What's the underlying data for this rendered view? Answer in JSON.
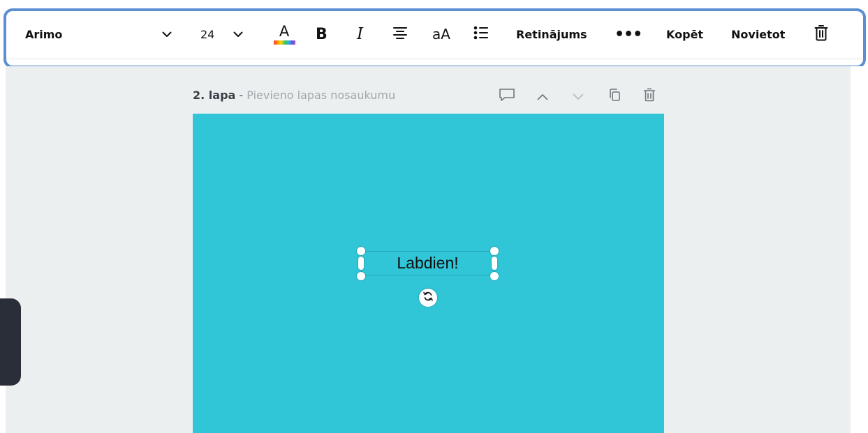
{
  "toolbar": {
    "font_name": "Arimo",
    "font_size": "24",
    "color_letter": "A",
    "bold_label": "B",
    "italic_label": "I",
    "case_label": "aA",
    "spacing_label": "Retinājums",
    "more_label": "•••",
    "copy_label": "Kopēt",
    "position_label": "Novietot",
    "icons": [
      "chevron-down-icon",
      "text-color-icon",
      "align-center-icon",
      "list-icon",
      "trash-icon"
    ]
  },
  "page": {
    "number_label": "2. lapa",
    "separator": " - ",
    "title_placeholder": "Pievieno lapas nosaukumu",
    "background_color": "#30c6d7",
    "actions": [
      "comment-icon",
      "chevron-up-icon",
      "chevron-down-icon",
      "duplicate-icon",
      "trash-icon"
    ]
  },
  "canvas": {
    "text_element": "Labdien!"
  },
  "colors": {
    "highlight": "#5b8fd1",
    "page_background": "#30c6d7",
    "workspace": "#ebeff0"
  }
}
